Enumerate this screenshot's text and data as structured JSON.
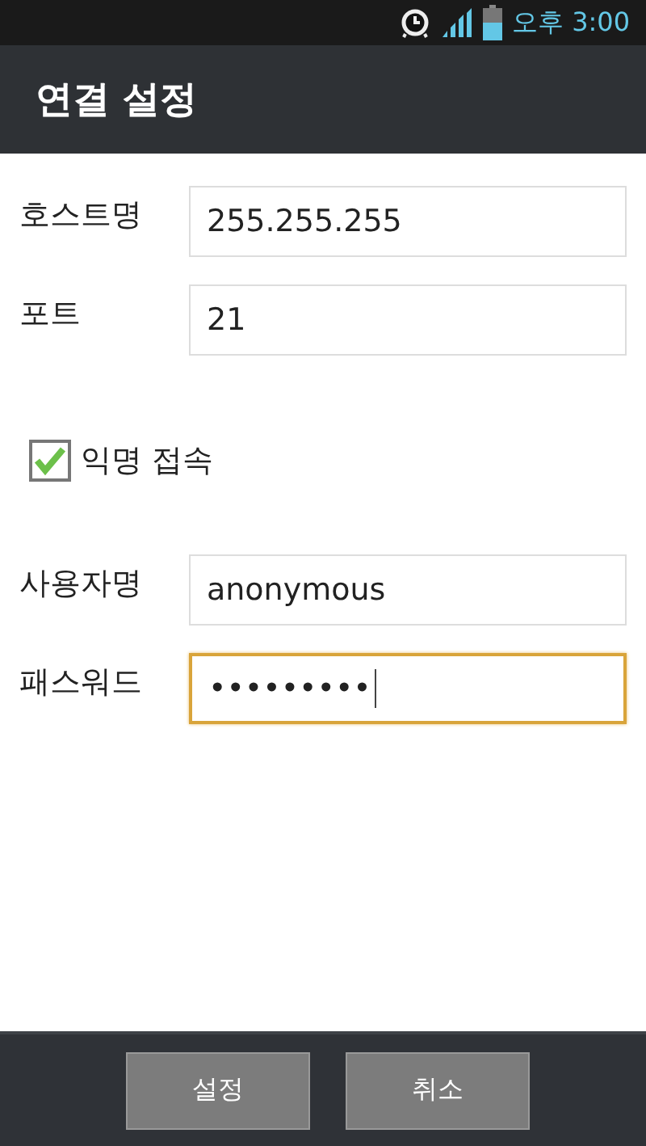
{
  "status_bar": {
    "time": "오후 3:00"
  },
  "title": "연결 설정",
  "server_fields": [
    {
      "label": "호스트명",
      "value": "255.255.255",
      "focused": false
    },
    {
      "label": "포트",
      "value": "21",
      "focused": false
    }
  ],
  "anonymous": {
    "label": "익명 접속",
    "checked": true
  },
  "login_fields": [
    {
      "label": "사용자명",
      "value": "anonymous",
      "focused": false
    },
    {
      "label": "패스워드",
      "value": "•••••••••",
      "focused": true
    }
  ],
  "buttons": [
    "설정",
    "취소"
  ]
}
